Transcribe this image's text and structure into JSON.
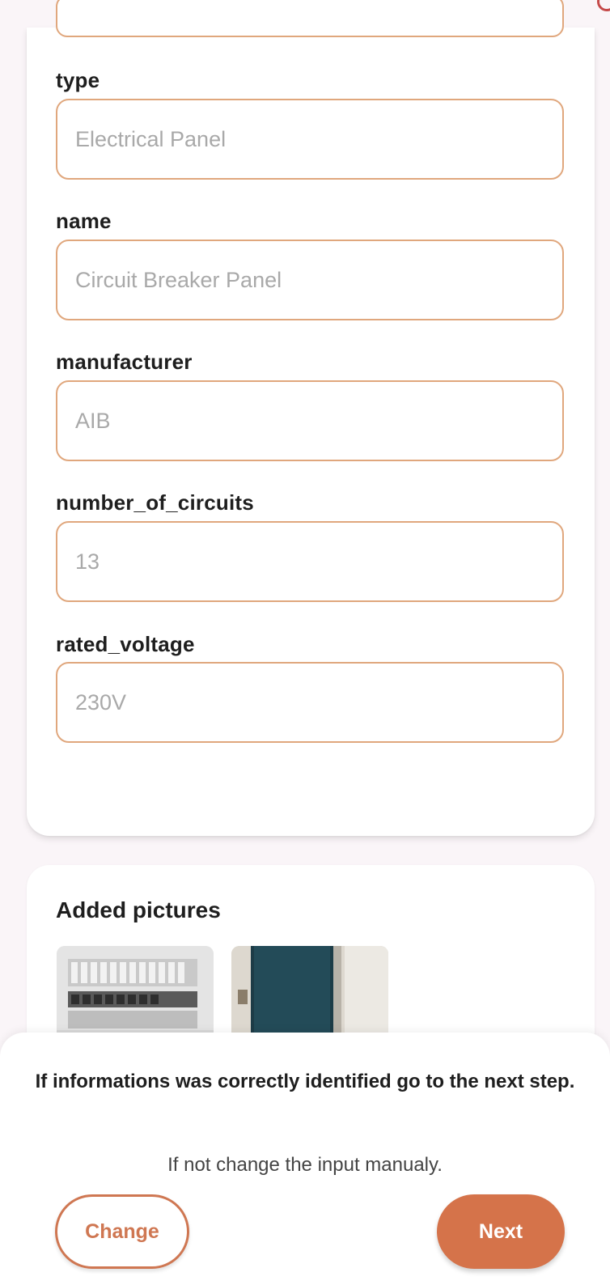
{
  "form": {
    "fields": [
      {
        "label": "type",
        "value": "Electrical Panel"
      },
      {
        "label": "name",
        "value": "Circuit Breaker Panel"
      },
      {
        "label": "manufacturer",
        "value": "AIB"
      },
      {
        "label": "number_of_circuits",
        "value": "13"
      },
      {
        "label": "rated_voltage",
        "value": "230V"
      }
    ]
  },
  "pictures": {
    "title": "Added pictures"
  },
  "sheet": {
    "message": "If informations was correctly identified go to the next step.",
    "sub_message": "If not change the input manualy.",
    "change_label": "Change",
    "next_label": "Next"
  },
  "colors": {
    "accent": "#d5734a",
    "field_border": "#e0a77d"
  }
}
